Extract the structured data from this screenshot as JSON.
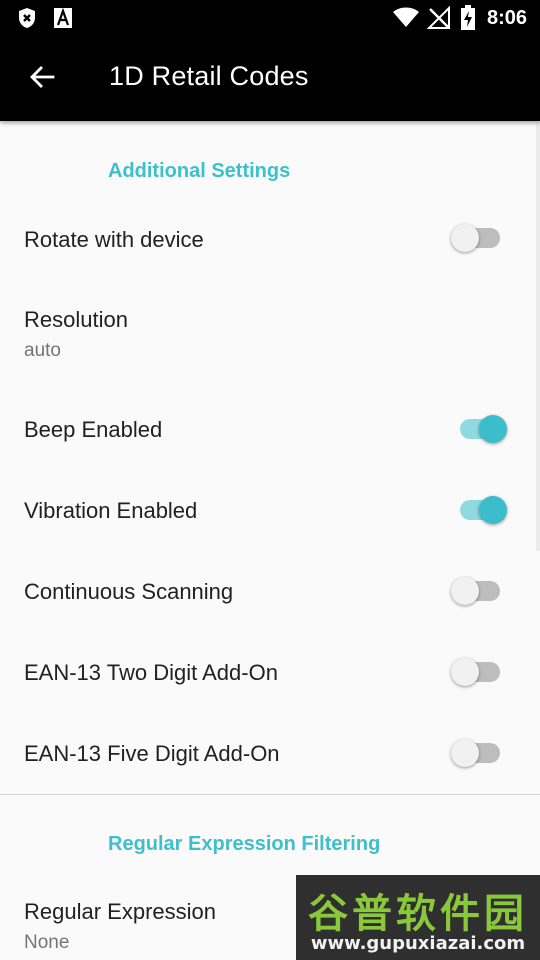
{
  "status_bar": {
    "time": "8:06",
    "icons": [
      "shield-x-icon",
      "font-a-icon",
      "wifi-icon",
      "no-signal-icon",
      "battery-charging-icon"
    ]
  },
  "app_bar": {
    "title": "1D Retail Codes",
    "back_icon": "arrow-back-icon"
  },
  "sections": {
    "additional": {
      "header": "Additional Settings"
    },
    "regex": {
      "header": "Regular Expression Filtering"
    }
  },
  "prefs": {
    "rotate": {
      "title": "Rotate with device",
      "enabled": false
    },
    "resolution": {
      "title": "Resolution",
      "summary": "auto"
    },
    "beep": {
      "title": "Beep Enabled",
      "enabled": true
    },
    "vibration": {
      "title": "Vibration Enabled",
      "enabled": true
    },
    "continuous": {
      "title": "Continuous Scanning",
      "enabled": false
    },
    "ean13_two": {
      "title": "EAN-13 Two Digit Add-On",
      "enabled": false
    },
    "ean13_five": {
      "title": "EAN-13 Five Digit Add-On",
      "enabled": false
    },
    "regex": {
      "title": "Regular Expression",
      "summary": "None"
    }
  },
  "watermark": {
    "text_cn": "谷普软件园",
    "url": "www.gupuxiazai.com"
  },
  "colors": {
    "accent": "#3dbfcc",
    "switch_on_thumb": "#3bbdcb",
    "switch_on_track": "#8fd9e0",
    "switch_off_track": "#bdbdbd",
    "appbar": "#000000"
  }
}
